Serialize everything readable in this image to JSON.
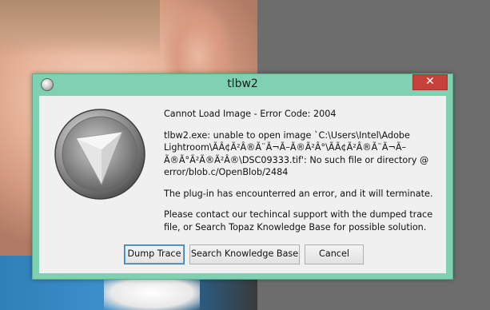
{
  "window": {
    "title": "tlbw2",
    "close_label": "✕"
  },
  "message": {
    "heading": "Cannot Load Image - Error Code: 2004",
    "detail": "tlbw2.exe: unable to open image `C:\\Users\\Intel\\Adobe Lightroom\\ÃÂ¢Ã²Â®Ã¨Ã¬Ã–Ã®Ã²Â°\\ÃÃ¢Ã²Â®Ã¨Ã¬Ã–Ã®Ã°Ã²Ã®Ã²Â®\\DSC09333.tif': No such file or directory @ error/blob.c/OpenBlob/2484",
    "notice": "The plug-in has encounterred an error, and it will terminate.",
    "contact": "Please contact our techincal support with the dumped trace file, or Search Topaz Knowledge Base for possible solution."
  },
  "buttons": {
    "dump_trace": "Dump Trace",
    "search_kb": "Search Knowledge Base",
    "cancel": "Cancel"
  },
  "icons": {
    "app": "topaz-logo-icon",
    "title": "app-title-icon",
    "close": "close-icon"
  },
  "colors": {
    "frame": "#7fd1b1",
    "close": "#c7413b",
    "client": "#f0f0f0"
  }
}
